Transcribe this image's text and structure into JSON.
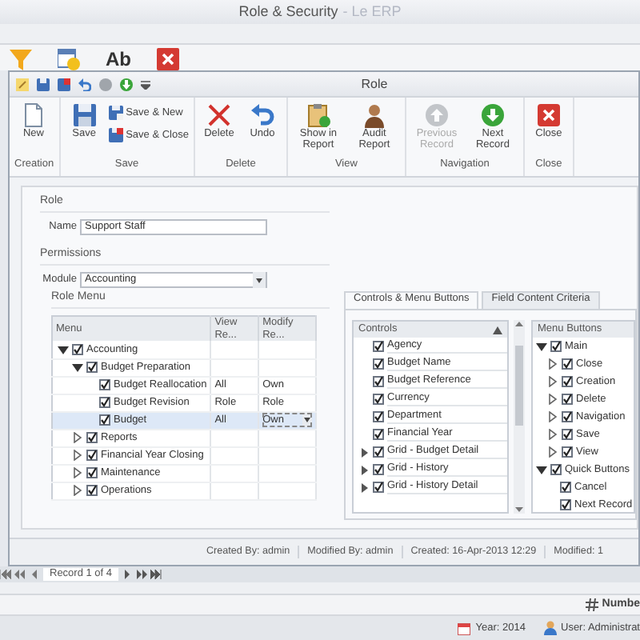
{
  "app": {
    "title": "Role & Security",
    "subtitle": "- Le ERP",
    "ribbon_text": "Ab"
  },
  "window": {
    "title": "Role"
  },
  "ribbon": [
    {
      "label": "Creation",
      "buttons": [
        {
          "label": "New",
          "kind": "new",
          "disabled": false
        }
      ]
    },
    {
      "label": "Save",
      "buttons": [
        {
          "label": "Save",
          "kind": "save",
          "disabled": false
        }
      ],
      "small_buttons": [
        {
          "label": "Save & New",
          "kind": "save-new"
        },
        {
          "label": "Save & Close",
          "kind": "save-close"
        }
      ]
    },
    {
      "label": "Delete",
      "buttons": [
        {
          "label": "Delete",
          "kind": "delete",
          "disabled": false
        },
        {
          "label": "Undo",
          "kind": "undo",
          "disabled": false
        }
      ]
    },
    {
      "label": "View",
      "buttons": [
        {
          "label": "Show in Report",
          "kind": "report",
          "disabled": false
        },
        {
          "label": "Audit Report",
          "kind": "audit",
          "disabled": false
        }
      ]
    },
    {
      "label": "Navigation",
      "buttons": [
        {
          "label": "Previous Record",
          "kind": "previous",
          "disabled": true
        },
        {
          "label": "Next Record",
          "kind": "next",
          "disabled": false
        }
      ]
    },
    {
      "label": "Close",
      "buttons": [
        {
          "label": "Close",
          "kind": "close",
          "disabled": false
        }
      ]
    }
  ],
  "form": {
    "role_section": "Role",
    "name_label": "Name",
    "name_value": "Support Staff",
    "permissions_section": "Permissions",
    "module_label": "Module",
    "module_value": "Accounting",
    "role_menu_section": "Role Menu"
  },
  "role_menu": {
    "columns": [
      "Menu",
      "View Re...",
      "Modify Re..."
    ],
    "rows": [
      {
        "label": "Accounting",
        "checked": true,
        "expandable": true,
        "expanded": true,
        "selected": false,
        "children": [
          {
            "label": "Budget Preparation",
            "checked": true,
            "expandable": true,
            "expanded": true,
            "selected": false,
            "children": [
              {
                "label": "Budget Reallocation",
                "checked": true,
                "expandable": false,
                "expanded": false,
                "selected": false,
                "view": "All",
                "modify": "Own"
              },
              {
                "label": "Budget Revision",
                "checked": true,
                "expandable": false,
                "expanded": false,
                "selected": false,
                "view": "Role",
                "modify": "Role"
              },
              {
                "label": "Budget",
                "checked": true,
                "expandable": false,
                "expanded": false,
                "selected": true,
                "view": "All",
                "modify": "Own"
              }
            ]
          },
          {
            "label": "Reports",
            "checked": true,
            "expandable": true,
            "expanded": false,
            "selected": false
          },
          {
            "label": "Financial Year Closing",
            "checked": true,
            "expandable": true,
            "expanded": false,
            "selected": false
          },
          {
            "label": "Maintenance",
            "checked": true,
            "expandable": true,
            "expanded": false,
            "selected": false
          },
          {
            "label": "Operations",
            "checked": true,
            "expandable": true,
            "expanded": false,
            "selected": false
          }
        ]
      }
    ]
  },
  "tabs": [
    {
      "label": "Controls & Menu Buttons",
      "selected": true
    },
    {
      "label": "Field Content Criteria",
      "selected": false
    }
  ],
  "controls": {
    "title": "Controls",
    "items": [
      {
        "label": "Agency",
        "checked": true,
        "expandable": false
      },
      {
        "label": "Budget Name",
        "checked": true,
        "expandable": false
      },
      {
        "label": "Budget Reference",
        "checked": true,
        "expandable": false
      },
      {
        "label": "Currency",
        "checked": true,
        "expandable": false
      },
      {
        "label": "Department",
        "checked": true,
        "expandable": false
      },
      {
        "label": "Financial Year",
        "checked": true,
        "expandable": false
      },
      {
        "label": "Grid - Budget Detail",
        "checked": true,
        "expandable": true
      },
      {
        "label": "Grid - History",
        "checked": true,
        "expandable": true
      },
      {
        "label": "Grid - History Detail",
        "checked": true,
        "expandable": true
      }
    ]
  },
  "menu_buttons": {
    "title": "Menu Buttons",
    "items": [
      {
        "label": "Main",
        "checked": true,
        "expandable": true,
        "expanded": true,
        "children": [
          {
            "label": "Close",
            "checked": true,
            "expandable": true,
            "expanded": false
          },
          {
            "label": "Creation",
            "checked": true,
            "expandable": true,
            "expanded": false
          },
          {
            "label": "Delete",
            "checked": true,
            "expandable": true,
            "expanded": false
          },
          {
            "label": "Navigation",
            "checked": true,
            "expandable": true,
            "expanded": false
          },
          {
            "label": "Save",
            "checked": true,
            "expandable": true,
            "expanded": false
          },
          {
            "label": "View",
            "checked": true,
            "expandable": true,
            "expanded": false
          }
        ]
      },
      {
        "label": "Quick Buttons",
        "checked": true,
        "expandable": true,
        "expanded": true,
        "children": [
          {
            "label": "Cancel",
            "checked": true,
            "expandable": false
          },
          {
            "label": "Next Record",
            "checked": true,
            "expandable": false
          }
        ]
      }
    ]
  },
  "status_bar": [
    "Created By: admin",
    "Modified By: admin",
    "Created: 16-Apr-2013 12:29",
    "Modified: 1"
  ],
  "record_nav": "Record 1 of 4",
  "number_label": "Numbe",
  "footer": {
    "year": "Year: 2014",
    "user": "User: Administrat"
  }
}
